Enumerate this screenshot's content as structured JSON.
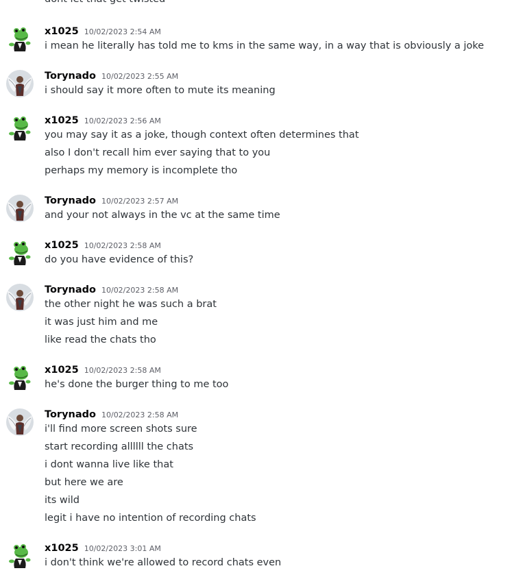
{
  "partial_top_line": "dont let that get twisted",
  "messages": [
    {
      "author": "x1025",
      "avatar": "frog-avatar-icon",
      "timestamp": "10/02/2023 2:54 AM",
      "lines": [
        "i mean he literally has told me to kms in the same way, in a way that is obviously a joke"
      ]
    },
    {
      "author": "Torynado",
      "avatar": "winged-avatar-icon",
      "timestamp": "10/02/2023 2:55 AM",
      "lines": [
        "i should say it more often to mute its meaning"
      ]
    },
    {
      "author": "x1025",
      "avatar": "frog-avatar-icon",
      "timestamp": "10/02/2023 2:56 AM",
      "lines": [
        "you may say it as a joke, though context often determines that",
        "also I don't recall him ever saying that to you",
        "perhaps my memory is incomplete tho"
      ]
    },
    {
      "author": "Torynado",
      "avatar": "winged-avatar-icon",
      "timestamp": "10/02/2023 2:57 AM",
      "lines": [
        "and your not always in the vc at the same time"
      ]
    },
    {
      "author": "x1025",
      "avatar": "frog-avatar-icon",
      "timestamp": "10/02/2023 2:58 AM",
      "lines": [
        "do you have evidence of this?"
      ]
    },
    {
      "author": "Torynado",
      "avatar": "winged-avatar-icon",
      "timestamp": "10/02/2023 2:58 AM",
      "lines": [
        "the other night he was such a brat",
        "it was just him and me",
        "like read the chats tho"
      ]
    },
    {
      "author": "x1025",
      "avatar": "frog-avatar-icon",
      "timestamp": "10/02/2023 2:58 AM",
      "lines": [
        "he's done the burger thing to me too"
      ]
    },
    {
      "author": "Torynado",
      "avatar": "winged-avatar-icon",
      "timestamp": "10/02/2023 2:58 AM",
      "lines": [
        "i'll find more screen shots sure",
        "start recording allllll the chats",
        "i dont wanna live like that",
        "but here we are",
        "its wild",
        "legit i have no intention of recording chats"
      ]
    },
    {
      "author": "x1025",
      "avatar": "frog-avatar-icon",
      "timestamp": "10/02/2023 3:01 AM",
      "lines": [
        "i don't think we're allowed to record chats even"
      ]
    }
  ]
}
